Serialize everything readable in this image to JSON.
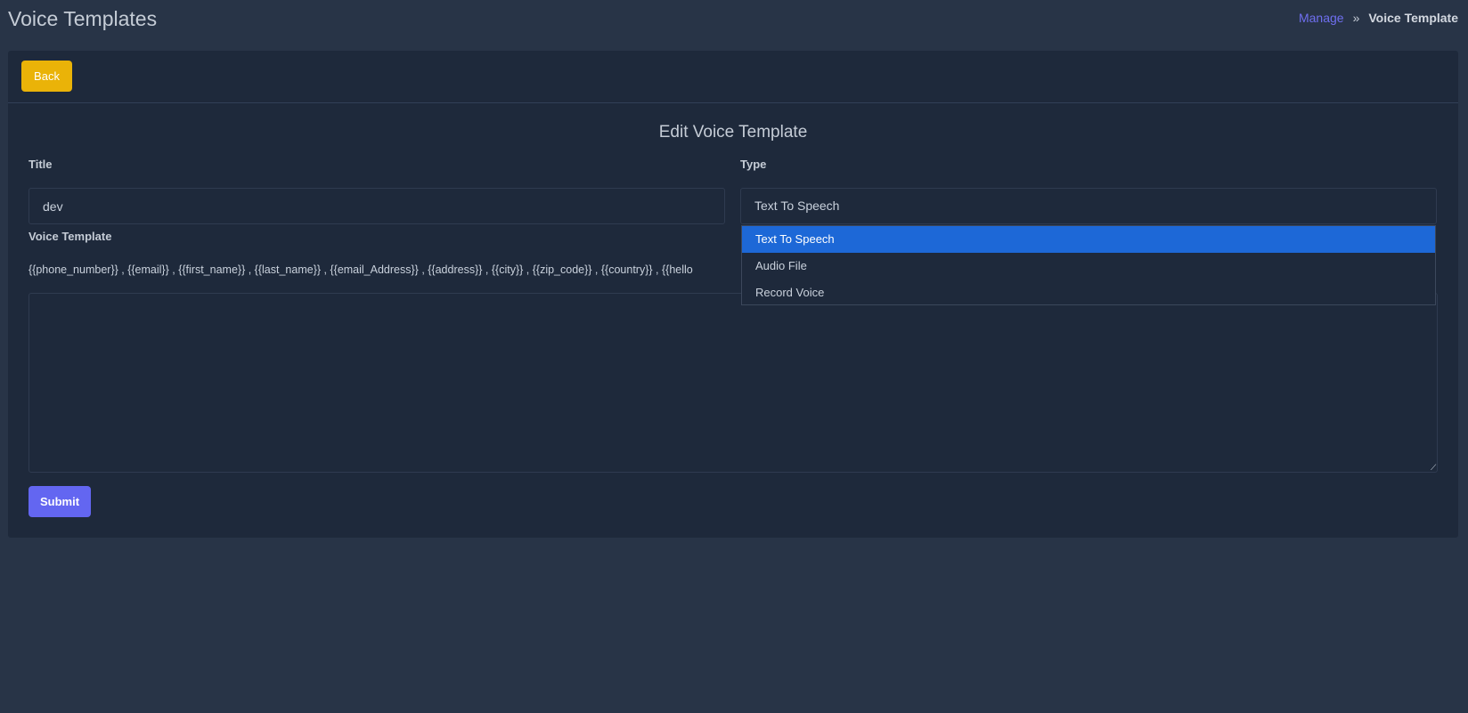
{
  "header": {
    "title": "Voice Templates",
    "breadcrumb": {
      "link": "Manage",
      "separator": "»",
      "current": "Voice Template"
    }
  },
  "card": {
    "back_label": "Back",
    "heading": "Edit Voice Template",
    "fields": {
      "title_label": "Title",
      "title_value": "dev",
      "type_label": "Type",
      "type_value": "Text To Speech",
      "type_options": [
        {
          "label": "Text To Speech",
          "selected": true
        },
        {
          "label": "Audio File",
          "selected": false
        },
        {
          "label": "Record Voice",
          "selected": false
        }
      ],
      "template_label": "Voice Template",
      "placeholders": "{{phone_number}} , {{email}} , {{first_name}} , {{last_name}} , {{email_Address}} , {{address}} , {{city}} , {{zip_code}} , {{country}} , {{hello",
      "template_value": ""
    },
    "submit_label": "Submit"
  },
  "colors": {
    "background": "#283447",
    "card": "#1e293b",
    "back_button": "#eab308",
    "submit_button": "#6366f1",
    "selected_option": "#1d68d7",
    "breadcrumb_link": "#6f6ff0"
  }
}
